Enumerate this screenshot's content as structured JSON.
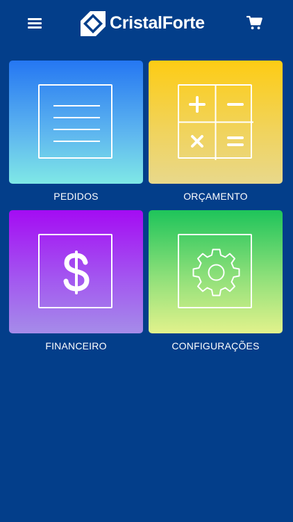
{
  "header": {
    "brand_name": "CristalForte",
    "menu_icon": "hamburger-menu-icon",
    "cart_icon": "shopping-cart-icon"
  },
  "tiles": [
    {
      "label": "PEDIDOS",
      "icon": "document-lines-icon",
      "colors": [
        "#2577f2",
        "#7fe8e6"
      ]
    },
    {
      "label": "ORÇAMENTO",
      "icon": "calculator-icon",
      "colors": [
        "#fdcc14",
        "#e8d88b"
      ]
    },
    {
      "label": "FINANCEIRO",
      "icon": "dollar-icon",
      "colors": [
        "#a40cf3",
        "#a58ce9"
      ]
    },
    {
      "label": "CONFIGURAÇÕES",
      "icon": "gear-icon",
      "colors": [
        "#1ec45a",
        "#e2f28c"
      ]
    }
  ],
  "colors": {
    "background": "#033e8a"
  }
}
